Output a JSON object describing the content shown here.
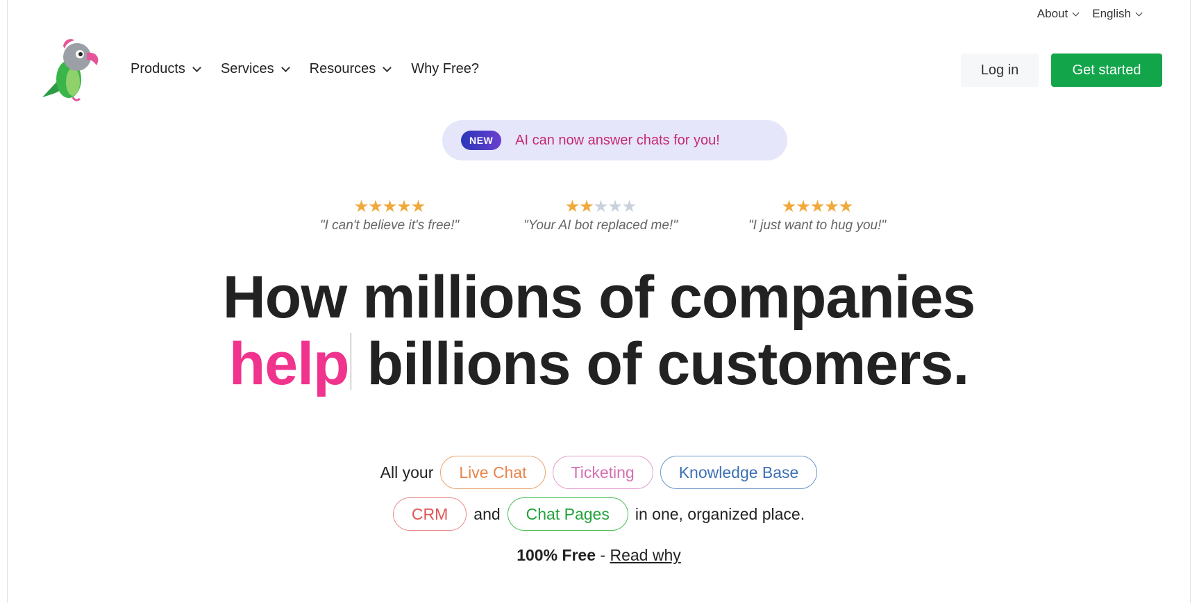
{
  "utility": {
    "about": "About",
    "language": "English"
  },
  "nav": {
    "products": "Products",
    "services": "Services",
    "resources": "Resources",
    "why_free": "Why Free?",
    "login": "Log in",
    "get_started": "Get started"
  },
  "announcement": {
    "badge": "NEW",
    "text": "AI can now answer chats for you!"
  },
  "testimonials": [
    {
      "stars": 5,
      "quote": "\"I can't believe it's free!\""
    },
    {
      "stars": 2,
      "quote": "\"Your AI bot replaced me!\""
    },
    {
      "stars": 5,
      "quote": "\"I just want to hug you!\""
    }
  ],
  "headline": {
    "line1": "How millions of companies",
    "accent": "help",
    "line2_rest": " billions of customers."
  },
  "features": {
    "prefix": "All your",
    "live_chat": "Live Chat",
    "ticketing": "Ticketing",
    "knowledge_base": "Knowledge Base",
    "crm": "CRM",
    "and": "and",
    "chat_pages": "Chat Pages",
    "suffix": "in one, organized place."
  },
  "free": {
    "label": "100% Free",
    "separator": " - ",
    "link": "Read why"
  },
  "colors": {
    "brand_green": "#12a54a",
    "accent_pink": "#f0338c",
    "star_gold": "#f0a93b"
  }
}
